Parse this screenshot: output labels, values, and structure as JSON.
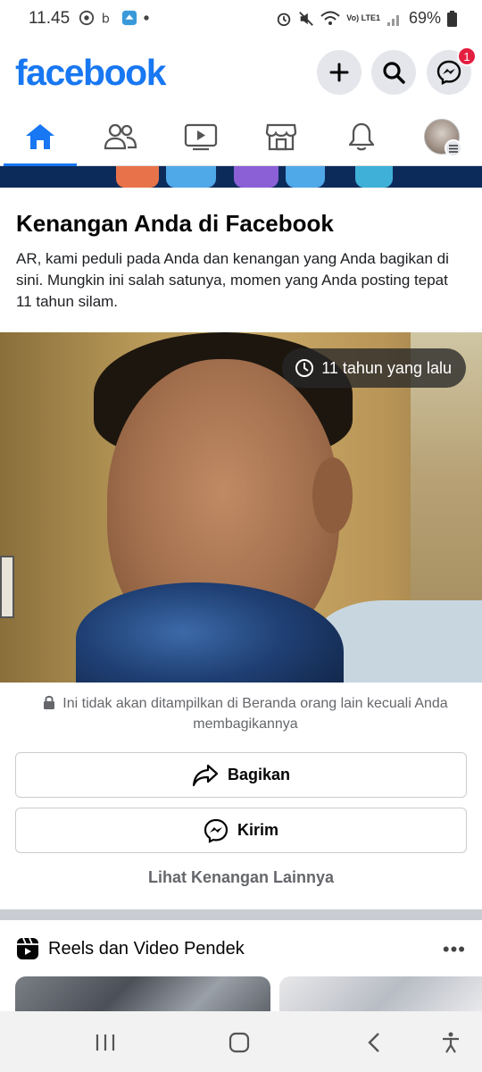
{
  "status_bar": {
    "time": "11.45",
    "battery": "69%",
    "network": "Vo) LTE1"
  },
  "header": {
    "logo": "facebook",
    "messenger_badge": "1",
    "accent_color": "#1877f2"
  },
  "tabs": [
    {
      "name": "home",
      "icon": "home-icon",
      "active": true
    },
    {
      "name": "friends",
      "icon": "friends-icon",
      "active": false
    },
    {
      "name": "watch",
      "icon": "video-icon",
      "active": false
    },
    {
      "name": "marketplace",
      "icon": "store-icon",
      "active": false
    },
    {
      "name": "notifications",
      "icon": "bell-icon",
      "active": false
    },
    {
      "name": "menu",
      "icon": "profile-avatar",
      "active": false
    }
  ],
  "memory": {
    "title": "Kenangan Anda di Facebook",
    "description": "AR, kami peduli pada Anda dan kenangan yang Anda bagikan di sini. Mungkin ini salah satunya, momen yang Anda posting tepat 11 tahun silam.",
    "time_ago": "11 tahun yang lalu",
    "privacy_note": "Ini tidak akan ditampilkan di Beranda orang lain kecuali Anda membagikannya",
    "share_label": "Bagikan",
    "send_label": "Kirim",
    "see_more_label": "Lihat Kenangan Lainnya"
  },
  "reels": {
    "title": "Reels dan Video Pendek",
    "more_label": "•••"
  }
}
